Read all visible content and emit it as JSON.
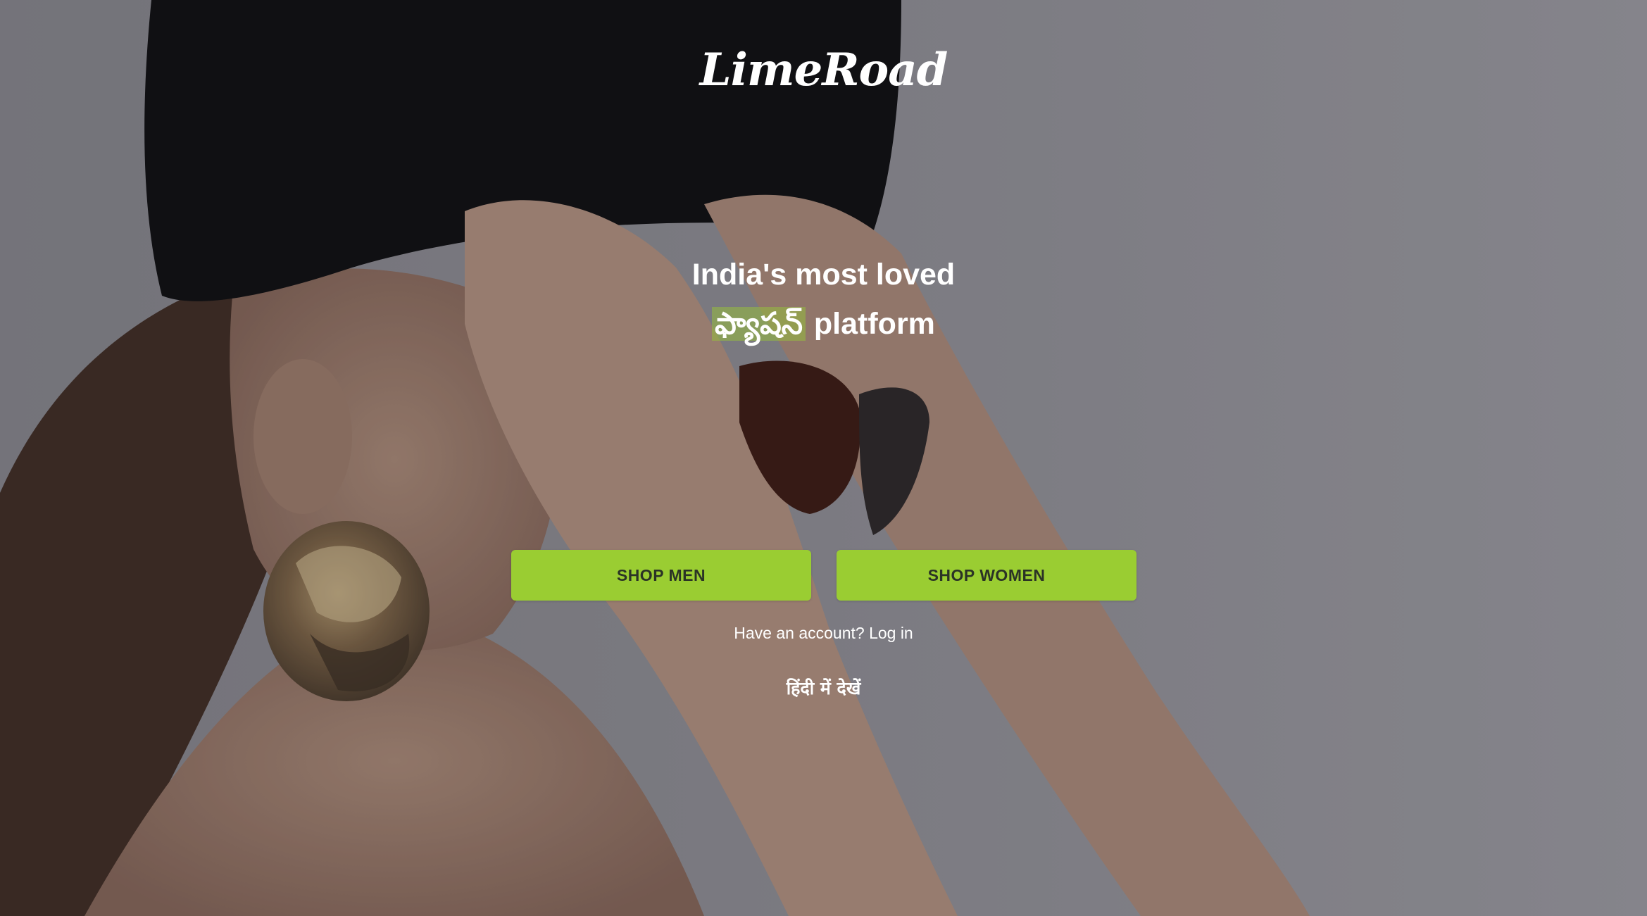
{
  "brand": {
    "logo_text": "LimeRoad"
  },
  "hero": {
    "tagline_line1": "India's most loved",
    "tagline_highlight": "ఫ్యాషన్",
    "tagline_suffix": "platform"
  },
  "actions": {
    "shop_men_label": "SHOP MEN",
    "shop_women_label": "SHOP WOMEN",
    "account_prompt": "Have an account?",
    "login_label": "Log in",
    "language_link": "हिंदी में देखें"
  },
  "colors": {
    "button_bg": "#9acd32",
    "button_text": "#2b3326",
    "highlight_bg": "#96be3c",
    "text": "#ffffff"
  }
}
